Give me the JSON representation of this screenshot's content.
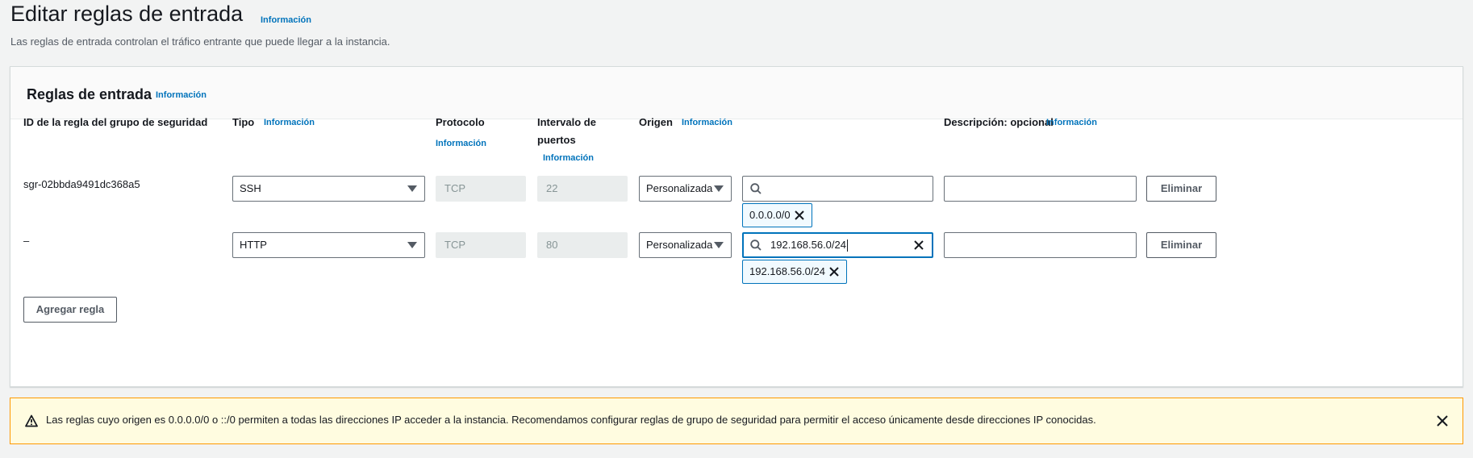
{
  "page": {
    "title": "Editar reglas de entrada",
    "info_link": "Información",
    "description": "Las reglas de entrada controlan el tráfico entrante que puede llegar a la instancia."
  },
  "panel": {
    "title": "Reglas de entrada",
    "info_link": "Información",
    "columns": {
      "rule_id": "ID de la regla del grupo de seguridad",
      "type": "Tipo",
      "type_info": "Información",
      "protocol": "Protocolo",
      "protocol_info": "Información",
      "port_range_line1": "Intervalo de",
      "port_range_line2": "puertos",
      "port_range_info": "Información",
      "source": "Origen",
      "source_info": "Información",
      "description": "Descripción: opcional",
      "description_info": "Información"
    },
    "rules": [
      {
        "id": "sgr-02bbda9491dc368a5",
        "type": "SSH",
        "protocol": "TCP",
        "port_range": "22",
        "source_type": "Personalizada",
        "source_search_value": "",
        "source_token": "0.0.0.0/0",
        "description_value": "",
        "delete_label": "Eliminar"
      },
      {
        "id": "–",
        "type": "HTTP",
        "protocol": "TCP",
        "port_range": "80",
        "source_type": "Personalizada",
        "source_search_value": "192.168.56.0/24",
        "source_token": "192.168.56.0/24",
        "description_value": "",
        "delete_label": "Eliminar"
      }
    ],
    "add_rule_label": "Agregar regla"
  },
  "warning": {
    "text": "Las reglas cuyo origen es 0.0.0.0/0 o ::/0 permiten a todas las direcciones IP acceder a la instancia. Recomendamos configurar reglas de grupo de seguridad para permitir el acceso únicamente desde direcciones IP conocidas."
  },
  "colors": {
    "link": "#0073bb",
    "focus_border": "#0073bb",
    "warning_border": "#ff9900",
    "warning_bg": "#fffce0"
  }
}
